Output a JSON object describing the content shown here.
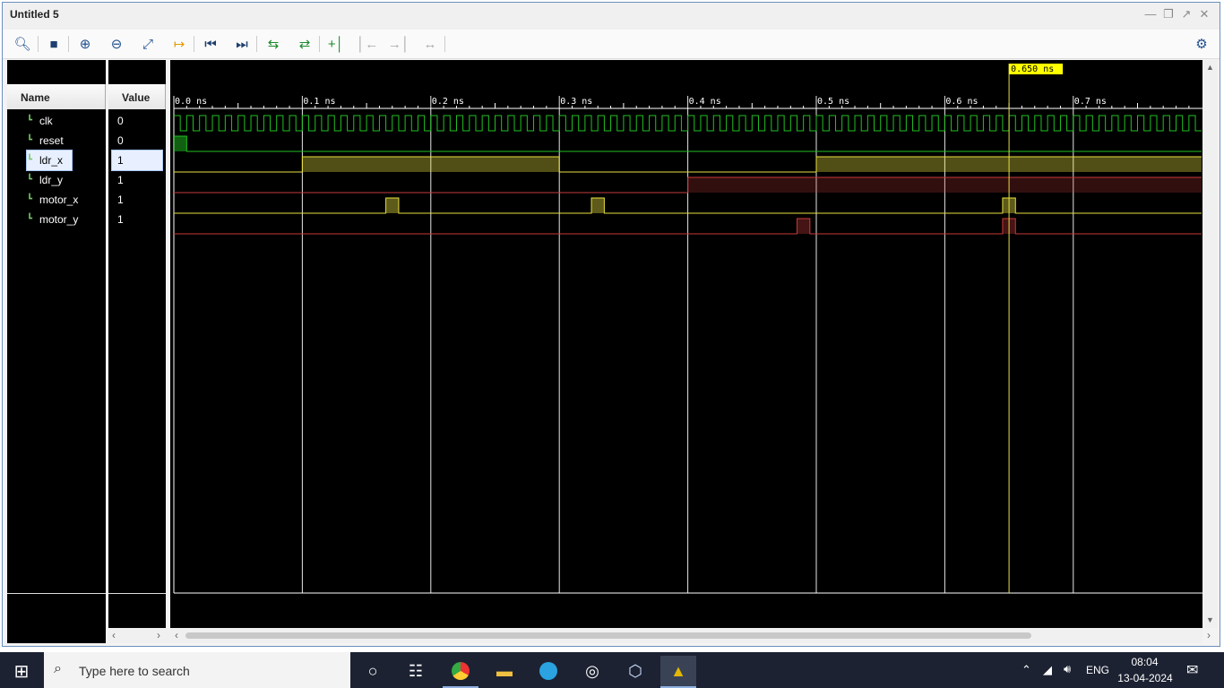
{
  "window": {
    "title": "Untitled 5"
  },
  "toolbar": {
    "icons": [
      "search-icon",
      "save-icon",
      "zoom-in-icon",
      "zoom-out-icon",
      "zoom-fit-icon",
      "goto-cursor-icon",
      "go-to-start-icon",
      "go-to-end-icon",
      "previous-transition-icon",
      "next-transition-icon",
      "add-marker-icon",
      "previous-marker-icon",
      "next-marker-icon",
      "swap-cursors-icon",
      "settings-icon"
    ]
  },
  "columns": {
    "name": "Name",
    "value": "Value"
  },
  "signals": [
    {
      "name": "clk",
      "value": "0",
      "color": "#22c022"
    },
    {
      "name": "reset",
      "value": "0",
      "color": "#22c022"
    },
    {
      "name": "ldr_x",
      "value": "1",
      "color": "#e8e040",
      "selected": true
    },
    {
      "name": "ldr_y",
      "value": "1",
      "color": "#c83a3a"
    },
    {
      "name": "motor_x",
      "value": "1",
      "color": "#e8e040"
    },
    {
      "name": "motor_y",
      "value": "1",
      "color": "#c83a3a"
    }
  ],
  "timeline": {
    "ticks": [
      "0.0 ns",
      "0.1 ns",
      "0.2 ns",
      "0.3 ns",
      "0.4 ns",
      "0.5 ns",
      "0.6 ns",
      "0.7 ns"
    ],
    "cursor_label": "0.650 ns",
    "cursor_time_ns": 0.65
  },
  "taskbar": {
    "search_placeholder": "Type here to search",
    "language": "ENG",
    "time": "08:04",
    "date": "13-04-2024"
  }
}
